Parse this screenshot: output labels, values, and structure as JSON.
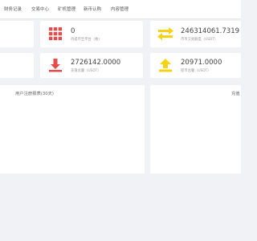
{
  "nav": {
    "items": [
      "财务记录",
      "交易中心",
      "矿机管理",
      "新币认购",
      "内容管理"
    ]
  },
  "stats": {
    "card1": {
      "icon": "grid-icon",
      "value": "0",
      "label": "待提币至平台（枚）",
      "color": "#e84a4a"
    },
    "card2": {
      "icon": "transfer-arrows-icon",
      "value": "246314061.7319",
      "label": "币币交易额度（USDT）",
      "color": "#f5d312"
    },
    "card3": {
      "icon": "download-icon",
      "value": "2726142.0000",
      "label": "充值总量（USDT）",
      "color": "#e84a4a"
    },
    "card4": {
      "icon": "upload-icon",
      "value": "20971.0000",
      "label": "提币总量（USDT）",
      "color": "#f5d312"
    }
  },
  "panels": {
    "left_title": "用户注册报表(30天)",
    "right_title": "充值"
  }
}
